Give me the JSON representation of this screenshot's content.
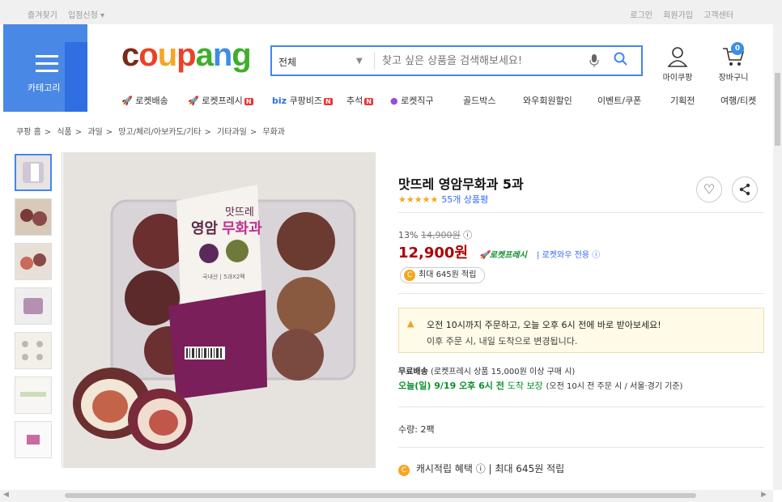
{
  "topbar": {
    "left": [
      "즐겨찾기",
      "입점신청 ▾"
    ],
    "right": [
      "로그인",
      "회원가입",
      "고객센터"
    ]
  },
  "category": {
    "label": "카테고리"
  },
  "search": {
    "category": "전체",
    "placeholder": "찾고 싶은 상품을 검색해보세요!"
  },
  "header": {
    "mycoupang": "마이쿠팡",
    "cart": "장바구니",
    "cart_count": "0"
  },
  "nav": [
    "로켓배송",
    "로켓프레시",
    "쿠팡비즈",
    "추석",
    "로켓직구",
    "골드박스",
    "와우회원할인",
    "이벤트/쿠폰",
    "기획전",
    "여행/티켓"
  ],
  "nav_biz": "biz",
  "breadcrumb": [
    "쿠팡 홈",
    ">",
    "식품",
    ">",
    "과일",
    ">",
    "망고/체리/아보카도/기타",
    ">",
    "기타과일",
    ">",
    "무화과"
  ],
  "product": {
    "title": "맛뜨레 영암무화과 5과",
    "stars": "★★★★★",
    "reviews": "55개 상품평",
    "discount": "13%",
    "original_price": "14,900원",
    "price": "12,900원",
    "rocket": "로켓프레시",
    "wow": "로켓와우 전용",
    "reward": "최대 645원 적립",
    "notice_l1": "오전 10시까지 주문하고, 오늘 오후 6시 전에 바로 받아보세요!",
    "notice_l2": "이후 주문 시, 내일 도착으로 변경됩니다.",
    "ship_free": "무료배송",
    "ship_cond": "(로켓프레시 상품 15,000원 이상 구매 시)",
    "ship_date": "오늘(일) 9/19 오후 6시 전",
    "ship_guarantee": "도착 보장",
    "ship_note": "(오전 10시 전 주문 시 / 서울·경기 기준)",
    "qty": "수량: 2팩",
    "cash_label": "캐시적립 혜택",
    "cash_value": "최대 645원 적립"
  },
  "package": {
    "brand": "맛뜨레",
    "name1": "영암",
    "name2": "무화과",
    "sub": "국내산 | 5과X2팩"
  },
  "colors": {
    "accent": "#346aff",
    "price": "#ae0000",
    "rocket": "#0a8f2a",
    "category": "#4a88e6"
  }
}
